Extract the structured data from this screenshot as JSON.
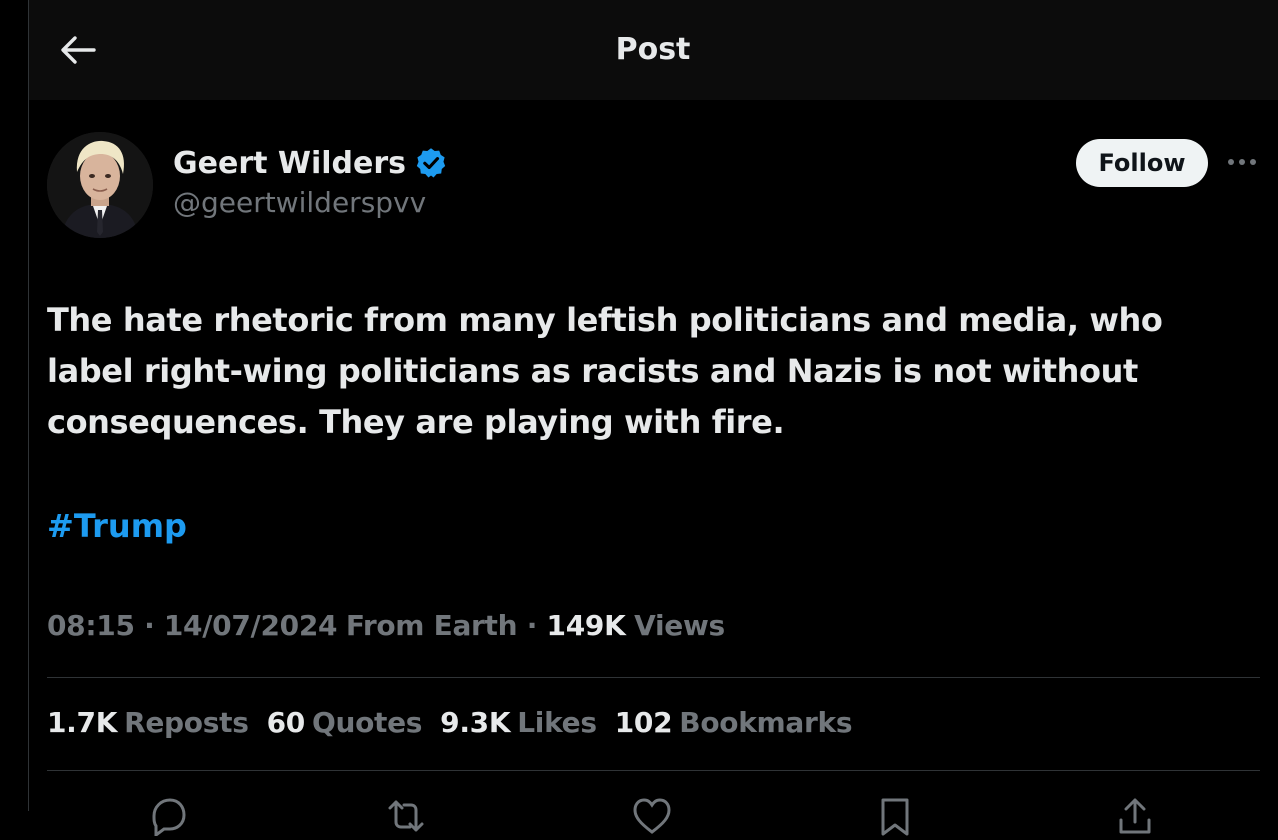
{
  "header": {
    "title": "Post"
  },
  "author": {
    "display_name": "Geert Wilders",
    "handle": "@geertwilderspvv",
    "verified": true,
    "follow_label": "Follow"
  },
  "tweet": {
    "text": "The hate rhetoric from many leftish politicians and media, who\nlabel right-wing politicians as racists and Nazis is not without\nconsequences. They are playing with fire.",
    "hashtag": "#Trump",
    "time": "08:15",
    "date": "14/07/2024",
    "source": "From Earth",
    "views_count": "149K",
    "views_label": "Views"
  },
  "stats": [
    {
      "count": "1.7K",
      "label": "Reposts"
    },
    {
      "count": "60",
      "label": "Quotes"
    },
    {
      "count": "9.3K",
      "label": "Likes"
    },
    {
      "count": "102",
      "label": "Bookmarks"
    }
  ],
  "icons": {
    "back": "arrow-left-icon",
    "verified": "verified-badge-icon",
    "more": "more-horizontal-icon",
    "actions": [
      "reply-icon",
      "repost-icon",
      "like-icon",
      "bookmark-icon",
      "share-icon"
    ]
  },
  "colors": {
    "background": "#000000",
    "header_background": "#0c0c0c",
    "primary_text": "#e7e9ea",
    "secondary_text": "#71767b",
    "accent": "#1d9bf0",
    "divider": "#2f3336"
  }
}
